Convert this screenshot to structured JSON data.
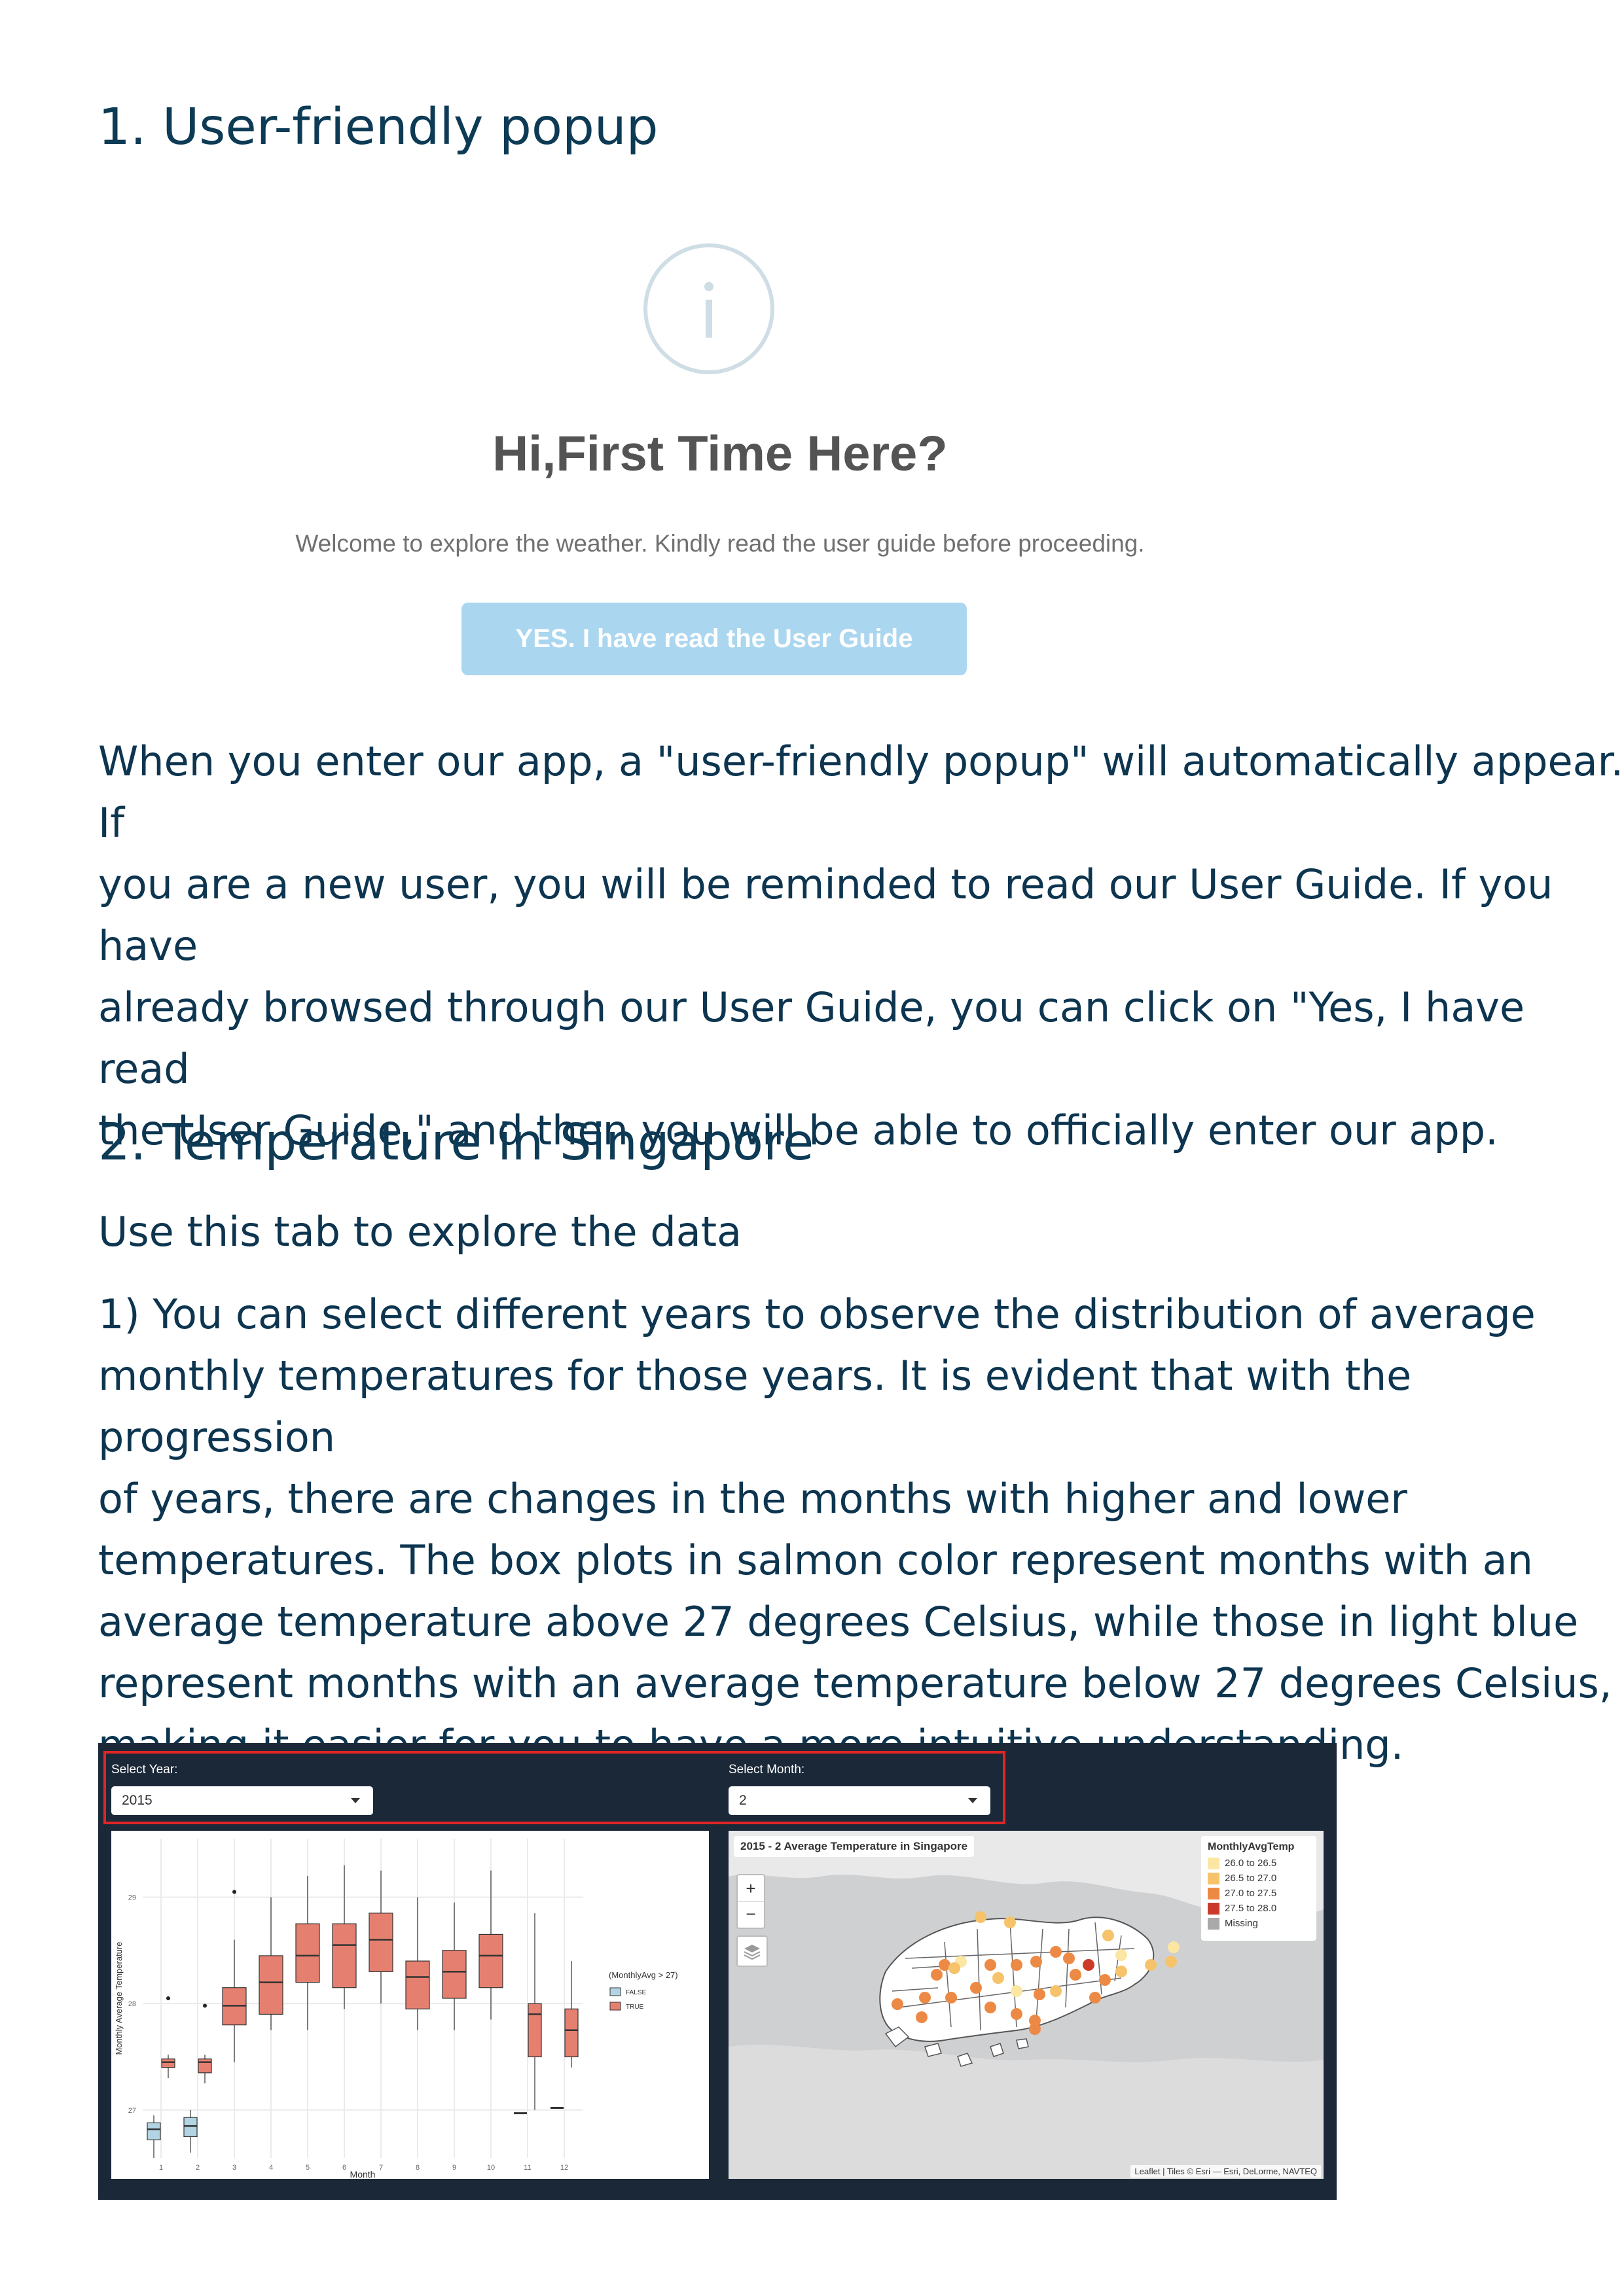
{
  "section1": {
    "heading": "1. User-friendly popup",
    "popup": {
      "icon": "info-icon",
      "title": "Hi,First Time Here?",
      "message": "Welcome to explore the weather. Kindly read the user guide before proceeding.",
      "button_label": "YES. I have read the User Guide"
    },
    "body_lines": [
      "When you enter our app, a \"user-friendly popup\" will automatically appear. If",
      "you are a new user, you will be reminded to read our User Guide. If you have",
      "already browsed through our User Guide, you can click on \"Yes, I have read",
      "the User Guide,\" and then you will be able to officially enter our app."
    ]
  },
  "section2": {
    "heading": "2. Temperature in Singapore",
    "subheading": "Use this tab to explore the data",
    "body_lines": [
      "1) You can select different years to observe the distribution of average",
      "monthly temperatures for those years. It is evident that with the progression",
      "of years, there are changes in the months with higher and lower",
      "temperatures. The box plots in salmon color represent months with an",
      "average temperature above 27 degrees Celsius, while those in light blue",
      "represent months with an average temperature below 27 degrees Celsius,",
      "making it easier for you to have a more intuitive understanding."
    ]
  },
  "dashboard": {
    "year_label": "Select Year:",
    "year_value": "2015",
    "month_label": "Select Month:",
    "month_value": "2",
    "colors": {
      "background": "#1b2838",
      "highlight": "#e02424",
      "salmon": "#e58070",
      "lightblue": "#b3d4e3"
    },
    "map": {
      "title": "2015 - 2 Average Temperature in Singapore",
      "zoom_in": "+",
      "zoom_out": "−",
      "legend_title": "MonthlyAvgTemp",
      "legend": [
        {
          "label": "26.0 to 26.5",
          "color": "#fbe6a3"
        },
        {
          "label": "26.5 to 27.0",
          "color": "#f6c36b"
        },
        {
          "label": "27.0 to 27.5",
          "color": "#ec8a45"
        },
        {
          "label": "27.5 to 28.0",
          "color": "#cc3a2a"
        },
        {
          "label": "Missing",
          "color": "#a9a9a9"
        }
      ],
      "attribution": "Leaflet | Tiles © Esri — Esri, DeLorme, NAVTEQ"
    }
  },
  "chart_data": {
    "type": "box",
    "title": "",
    "xlabel": "Month",
    "ylabel": "Monthly Average Temperature",
    "categories": [
      "1",
      "2",
      "3",
      "4",
      "5",
      "6",
      "7",
      "8",
      "9",
      "10",
      "11",
      "12"
    ],
    "yticks": [
      27,
      28,
      29
    ],
    "ylim": [
      26.55,
      29.55
    ],
    "legend_title": "(MonthlyAvg > 27)",
    "legend": [
      {
        "name": "FALSE",
        "color": "#b3d4e3"
      },
      {
        "name": "TRUE",
        "color": "#e58070"
      }
    ],
    "boxes": [
      {
        "month": "1",
        "group": "FALSE",
        "min": 26.55,
        "q1": 26.72,
        "median": 26.82,
        "q3": 26.88,
        "max": 26.95
      },
      {
        "month": "1",
        "group": "TRUE",
        "min": 27.3,
        "q1": 27.4,
        "median": 27.45,
        "q3": 27.48,
        "max": 27.52,
        "outliers": [
          28.05
        ]
      },
      {
        "month": "2",
        "group": "FALSE",
        "min": 26.6,
        "q1": 26.75,
        "median": 26.85,
        "q3": 26.93,
        "max": 27.0
      },
      {
        "month": "2",
        "group": "TRUE",
        "min": 27.25,
        "q1": 27.35,
        "median": 27.45,
        "q3": 27.48,
        "max": 27.52,
        "outliers": [
          27.98
        ]
      },
      {
        "month": "3",
        "group": "TRUE",
        "min": 27.45,
        "q1": 27.8,
        "median": 27.98,
        "q3": 28.15,
        "max": 28.6,
        "outliers": [
          29.05
        ]
      },
      {
        "month": "4",
        "group": "TRUE",
        "min": 27.75,
        "q1": 27.9,
        "median": 28.2,
        "q3": 28.45,
        "max": 29.0
      },
      {
        "month": "5",
        "group": "TRUE",
        "min": 27.75,
        "q1": 28.2,
        "median": 28.45,
        "q3": 28.75,
        "max": 29.2
      },
      {
        "month": "6",
        "group": "TRUE",
        "min": 27.95,
        "q1": 28.15,
        "median": 28.55,
        "q3": 28.75,
        "max": 29.3
      },
      {
        "month": "7",
        "group": "TRUE",
        "min": 28.0,
        "q1": 28.3,
        "median": 28.6,
        "q3": 28.85,
        "max": 29.25
      },
      {
        "month": "8",
        "group": "TRUE",
        "min": 27.75,
        "q1": 27.95,
        "median": 28.25,
        "q3": 28.4,
        "max": 29.0
      },
      {
        "month": "9",
        "group": "TRUE",
        "min": 27.75,
        "q1": 28.05,
        "median": 28.3,
        "q3": 28.5,
        "max": 28.95
      },
      {
        "month": "10",
        "group": "TRUE",
        "min": 27.85,
        "q1": 28.15,
        "median": 28.45,
        "q3": 28.65,
        "max": 29.25
      },
      {
        "month": "11",
        "group": "TRUE",
        "min": 27.0,
        "q1": 27.5,
        "median": 27.9,
        "q3": 28.0,
        "max": 28.85
      },
      {
        "month": "11",
        "group": "FALSE",
        "min": 26.97,
        "q1": 26.97,
        "median": 26.97,
        "q3": 26.97,
        "max": 26.97
      },
      {
        "month": "12",
        "group": "TRUE",
        "min": 27.4,
        "q1": 27.5,
        "median": 27.75,
        "q3": 27.95,
        "max": 28.4
      },
      {
        "month": "12",
        "group": "FALSE",
        "min": 27.02,
        "q1": 27.02,
        "median": 27.02,
        "q3": 27.02,
        "max": 27.02
      }
    ]
  }
}
